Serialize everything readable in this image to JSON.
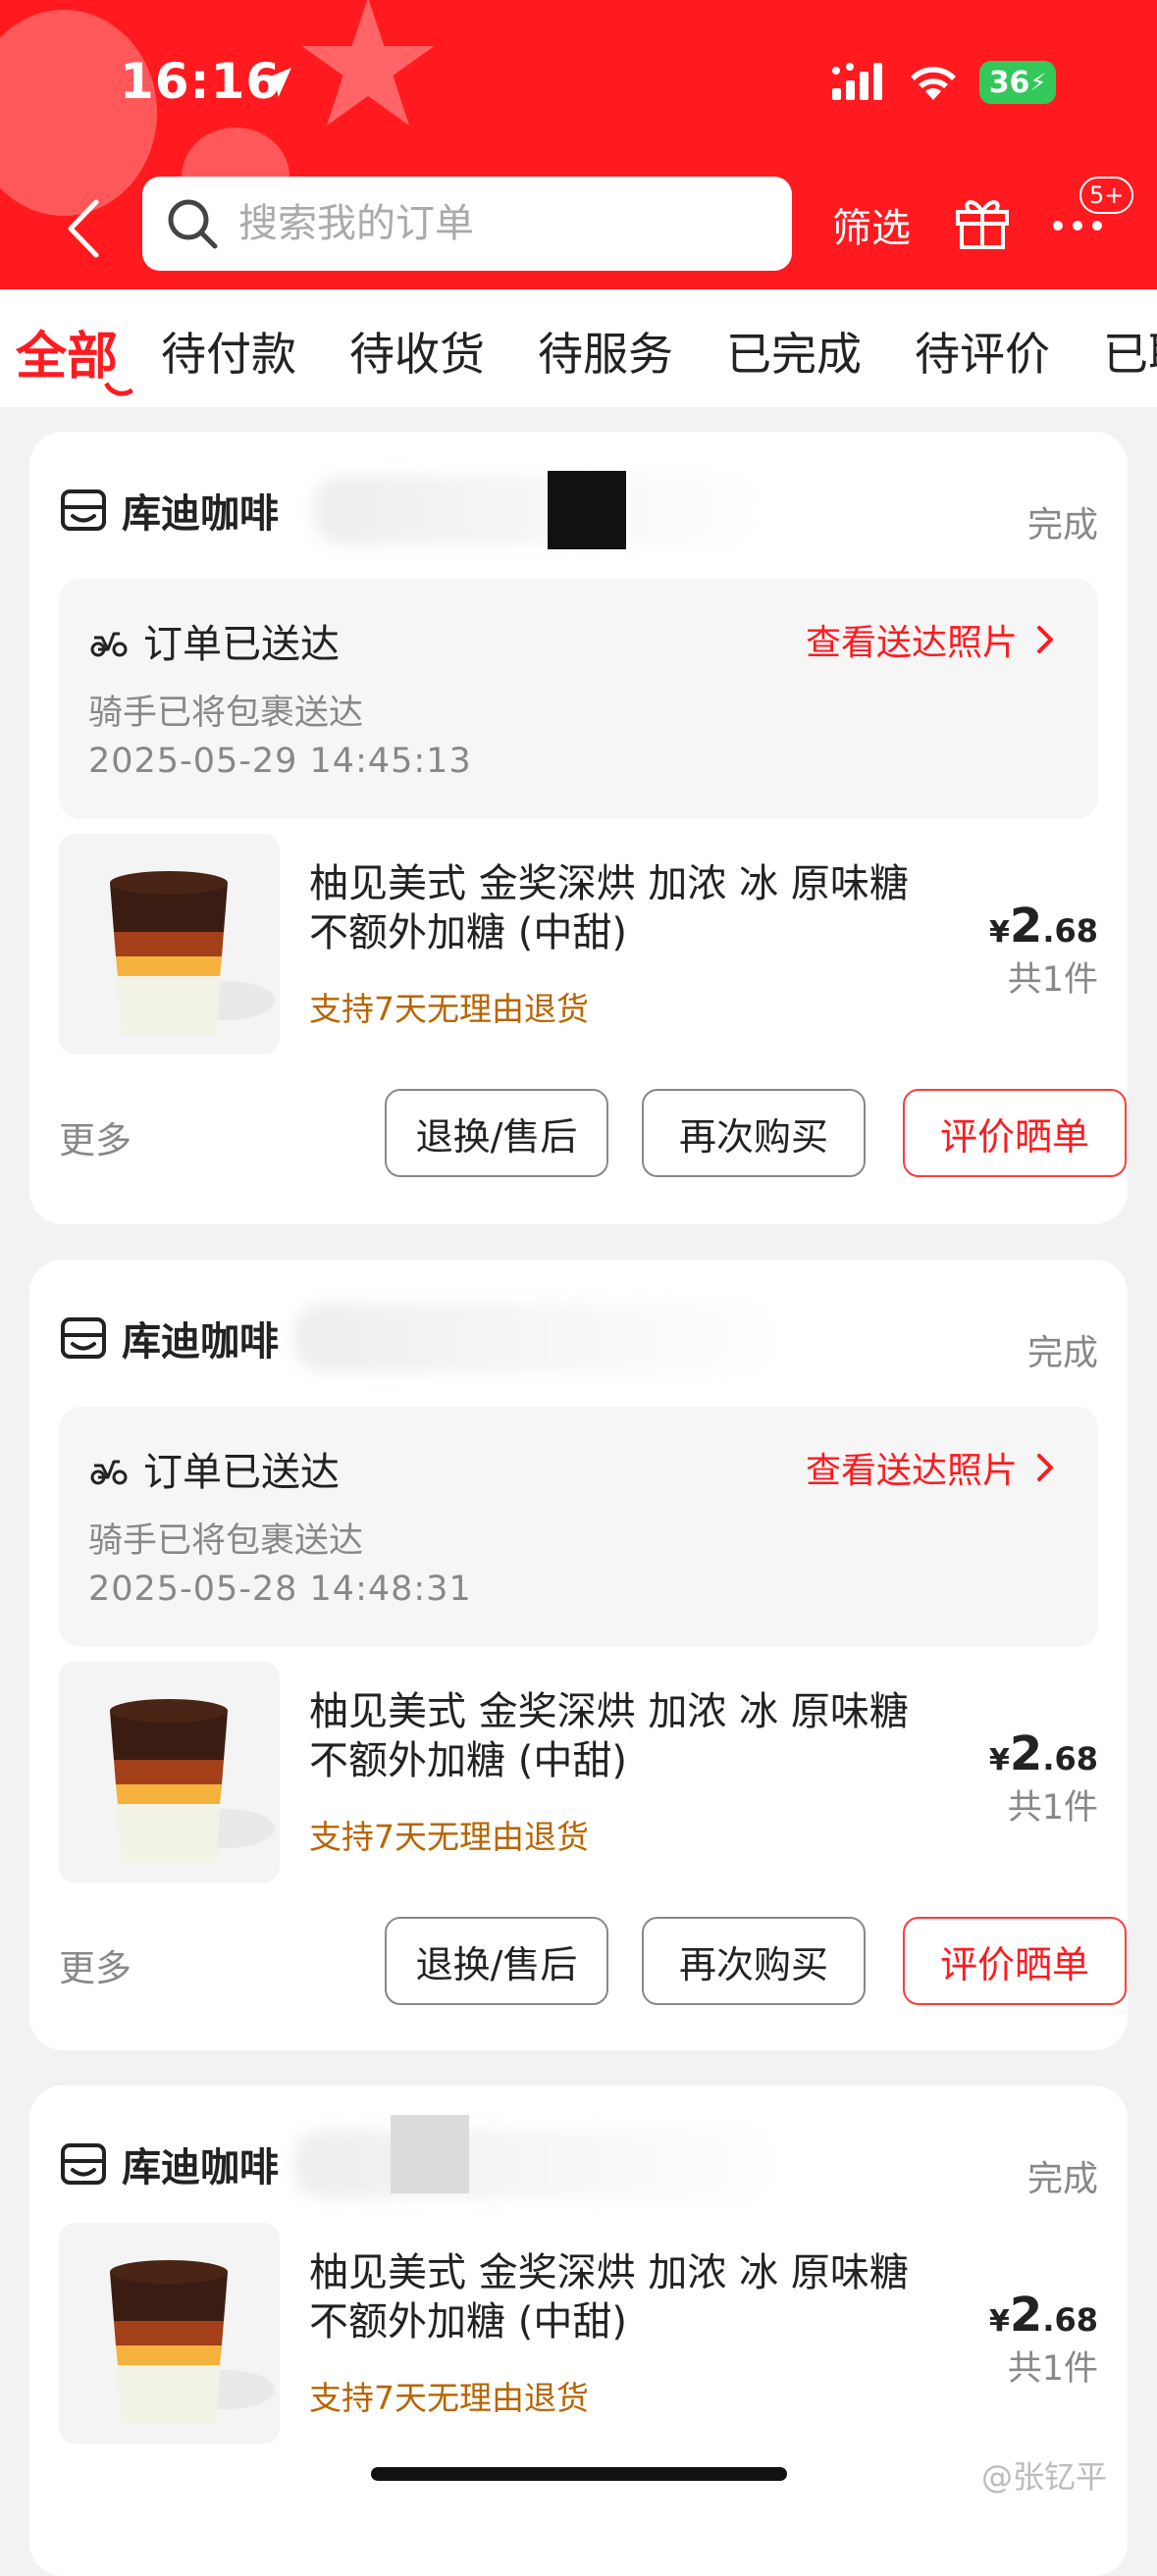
{
  "status_bar": {
    "time": "16:16",
    "battery": "36"
  },
  "header": {
    "search_placeholder": "搜索我的订单",
    "filter_label": "筛选",
    "more_badge": "5+"
  },
  "tabs": [
    "全部",
    "待付款",
    "待收货",
    "待服务",
    "已完成",
    "待评价",
    "已取"
  ],
  "orders": [
    {
      "store": "库迪咖啡",
      "status": "完成",
      "delivery_title": "订单已送达",
      "delivery_sub": "骑手已将包裹送达",
      "delivery_time": "2025-05-29 14:45:13",
      "photo_link": "查看送达照片",
      "product_name": "柚见美式 金奖深烘 加浓 冰 原味糖 不额外加糖 (中甜)",
      "product_tag": "支持7天无理由退货",
      "price_currency": "¥",
      "price_int": "2",
      "price_dec": ".68",
      "qty": "共1件",
      "more": "更多",
      "btn_after_sale": "退换/售后",
      "btn_rebuy": "再次购买",
      "btn_review": "评价晒单"
    },
    {
      "store": "库迪咖啡",
      "status": "完成",
      "delivery_title": "订单已送达",
      "delivery_sub": "骑手已将包裹送达",
      "delivery_time": "2025-05-28 14:48:31",
      "photo_link": "查看送达照片",
      "product_name": "柚见美式 金奖深烘 加浓 冰 原味糖 不额外加糖 (中甜)",
      "product_tag": "支持7天无理由退货",
      "price_currency": "¥",
      "price_int": "2",
      "price_dec": ".68",
      "qty": "共1件",
      "more": "更多",
      "btn_after_sale": "退换/售后",
      "btn_rebuy": "再次购买",
      "btn_review": "评价晒单"
    },
    {
      "store": "库迪咖啡",
      "status": "完成",
      "product_name": "柚见美式 金奖深烘 加浓 冰 原味糖 不额外加糖 (中甜)",
      "product_tag": "支持7天无理由退货",
      "price_currency": "¥",
      "price_int": "2",
      "price_dec": ".68",
      "qty": "共1件"
    }
  ],
  "watermark": "@张钇平",
  "colors": {
    "brand_red": "#ff1a1f",
    "tag_orange": "#b86500"
  }
}
